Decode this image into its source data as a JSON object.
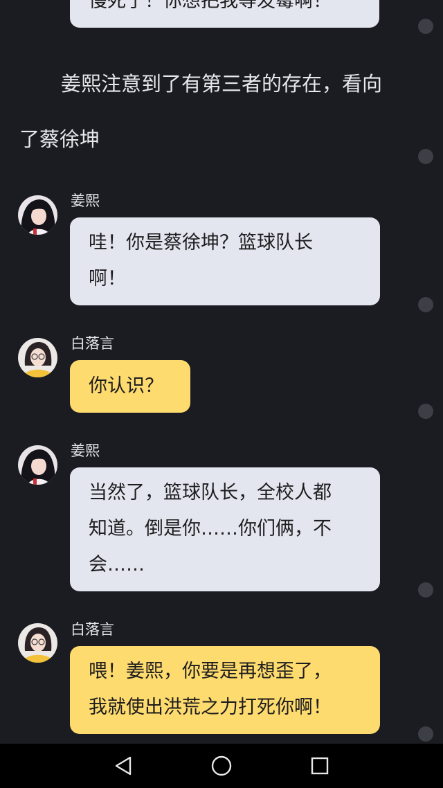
{
  "messages": {
    "top_partial": {
      "text": "慢死了！你想把我等发霉啊！"
    },
    "narration": {
      "line1": "姜熙注意到了有第三者的存在，看向",
      "line2": "了蔡徐坤"
    },
    "m1": {
      "sender": "姜熙",
      "line1": "哇！你是蔡徐坤？篮球队长",
      "line2": "啊！",
      "color": "#e3e6ee"
    },
    "m2": {
      "sender": "白落言",
      "line1": "你认识？",
      "color": "#fedb6e"
    },
    "m3": {
      "sender": "姜熙",
      "line1": "当然了，篮球队长，全校人都",
      "line2": "知道。倒是你……你们俩，不",
      "line3": "会……",
      "color": "#e3e6ee"
    },
    "m4": {
      "sender": "白落言",
      "line1": "喂！姜熙，你要是再想歪了，",
      "line2": "我就使出洪荒之力打死你啊！",
      "color": "#fedb6e"
    }
  },
  "nav_bar": {
    "back_icon": "triangle-back-icon",
    "home_icon": "circle-home-icon",
    "recents_icon": "square-recents-icon"
  },
  "colors": {
    "background": "#1b1c22",
    "bubble_gray": "#e3e6ee",
    "bubble_yellow": "#fedb6e",
    "dot": "#3d3f47"
  }
}
